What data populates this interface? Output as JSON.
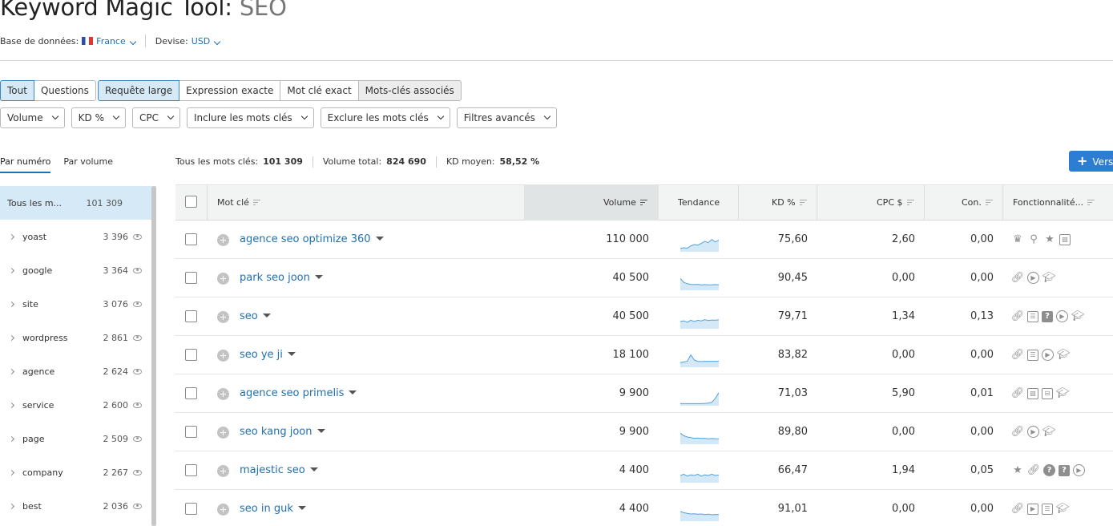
{
  "title": {
    "prefix": "Keyword Magic Tool:",
    "keyword": "SEO"
  },
  "meta": {
    "db_label": "Base de données:",
    "db_value": "France",
    "currency_label": "Devise:",
    "currency_value": "USD"
  },
  "seg1": [
    "Tout",
    "Questions"
  ],
  "seg2": [
    "Requête large",
    "Expression exacte",
    "Mot clé exact",
    "Mots-clés associés"
  ],
  "filters": [
    "Volume",
    "KD %",
    "CPC",
    "Inclure les mots clés",
    "Exclure les mots clés",
    "Filtres avancés"
  ],
  "left_tabs": [
    "Par numéro",
    "Par volume"
  ],
  "totals": {
    "all_label": "Tous les mots clés:",
    "all_value": "101 309",
    "vol_label": "Volume total:",
    "vol_value": "824 690",
    "kd_label": "KD moyen:",
    "kd_value": "58,52 %"
  },
  "export_button": "Vers",
  "sidebar": {
    "all": {
      "label": "Tous les m...",
      "count": "101 309"
    },
    "groups": [
      {
        "label": "yoast",
        "count": "3 396"
      },
      {
        "label": "google",
        "count": "3 364"
      },
      {
        "label": "site",
        "count": "3 076"
      },
      {
        "label": "wordpress",
        "count": "2 861"
      },
      {
        "label": "agence",
        "count": "2 624"
      },
      {
        "label": "service",
        "count": "2 600"
      },
      {
        "label": "page",
        "count": "2 509"
      },
      {
        "label": "company",
        "count": "2 267"
      },
      {
        "label": "best",
        "count": "2 036"
      }
    ]
  },
  "columns": {
    "keyword": "Mot clé",
    "volume": "Volume",
    "trend": "Tendance",
    "kd": "KD %",
    "cpc": "CPC $",
    "com": "Con.",
    "features": "Fonctionnalité..."
  },
  "rows": [
    {
      "keyword": "agence seo optimize 360",
      "volume": "110 000",
      "kd": "75,60",
      "cpc": "2,60",
      "com": "0,00",
      "trend": [
        0.2,
        0.25,
        0.22,
        0.4,
        0.5,
        0.45,
        0.6,
        0.75,
        0.65,
        0.9,
        0.7,
        0.85
      ],
      "features": [
        "crown-icon",
        "location-pin-icon",
        "star-icon",
        "image-icon"
      ]
    },
    {
      "keyword": "park seo joon",
      "volume": "40 500",
      "kd": "90,45",
      "cpc": "0,00",
      "com": "0,00",
      "trend": [
        0.85,
        0.55,
        0.45,
        0.4,
        0.38,
        0.4,
        0.35,
        0.38,
        0.36,
        0.37,
        0.38,
        0.37
      ],
      "features": [
        "link-icon",
        "video-icon",
        "graduation-cap-icon"
      ]
    },
    {
      "keyword": "seo",
      "volume": "40 500",
      "kd": "79,71",
      "cpc": "1,34",
      "com": "0,13",
      "trend": [
        0.5,
        0.55,
        0.45,
        0.6,
        0.5,
        0.6,
        0.55,
        0.65,
        0.58,
        0.62,
        0.6,
        0.64
      ],
      "features": [
        "link-icon",
        "news-icon",
        "faq-icon",
        "video-icon",
        "graduation-cap-icon"
      ]
    },
    {
      "keyword": "seo ye ji",
      "volume": "18 100",
      "kd": "83,82",
      "cpc": "0,00",
      "com": "0,00",
      "trend": [
        0.3,
        0.35,
        0.4,
        0.9,
        0.5,
        0.4,
        0.38,
        0.4,
        0.39,
        0.4,
        0.4,
        0.4
      ],
      "features": [
        "link-icon",
        "news-icon",
        "video-icon",
        "graduation-cap-icon"
      ]
    },
    {
      "keyword": "agence seo primelis",
      "volume": "9 900",
      "kd": "71,03",
      "cpc": "5,90",
      "com": "0,01",
      "trend": [
        0.1,
        0.1,
        0.1,
        0.1,
        0.1,
        0.1,
        0.1,
        0.12,
        0.14,
        0.2,
        0.5,
        0.95
      ],
      "features": [
        "link-icon",
        "image-icon",
        "briefcase-icon",
        "graduation-cap-icon"
      ]
    },
    {
      "keyword": "seo kang joon",
      "volume": "9 900",
      "kd": "89,80",
      "cpc": "0,00",
      "com": "0,00",
      "trend": [
        0.8,
        0.6,
        0.5,
        0.45,
        0.4,
        0.42,
        0.38,
        0.4,
        0.36,
        0.38,
        0.37,
        0.36
      ],
      "features": [
        "link-icon",
        "video-icon",
        "graduation-cap-icon"
      ]
    },
    {
      "keyword": "majestic seo",
      "volume": "4 400",
      "kd": "66,47",
      "cpc": "1,94",
      "com": "0,05",
      "trend": [
        0.5,
        0.6,
        0.45,
        0.55,
        0.5,
        0.6,
        0.45,
        0.55,
        0.5,
        0.6,
        0.5,
        0.55
      ],
      "features": [
        "star-icon",
        "link-icon",
        "help-icon",
        "faq-icon",
        "video-icon"
      ]
    },
    {
      "keyword": "seo in guk",
      "volume": "4 400",
      "kd": "91,01",
      "cpc": "0,00",
      "com": "0,00",
      "trend": [
        0.7,
        0.6,
        0.55,
        0.5,
        0.52,
        0.48,
        0.5,
        0.45,
        0.48,
        0.44,
        0.46,
        0.45
      ],
      "features": [
        "link-icon",
        "video-box-icon",
        "news-icon",
        "graduation-cap-icon"
      ]
    }
  ]
}
